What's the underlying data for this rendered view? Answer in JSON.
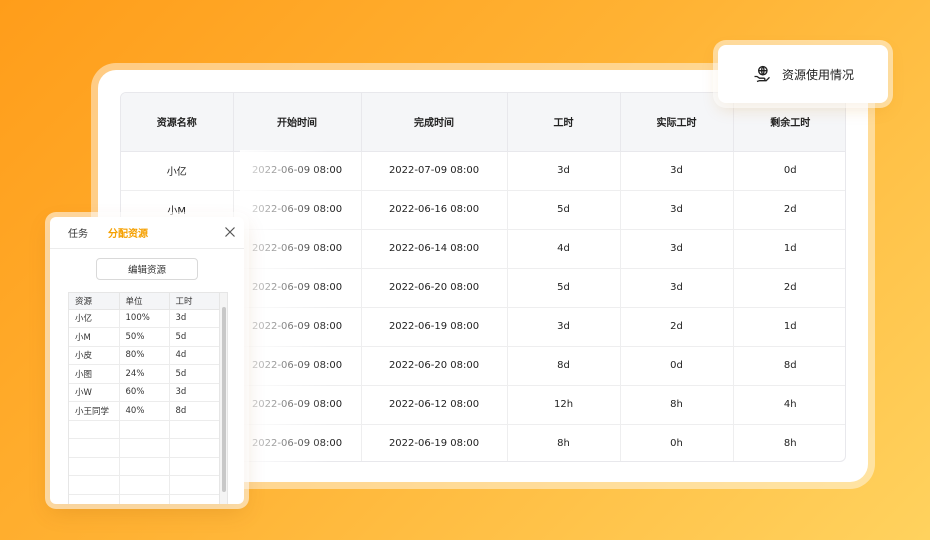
{
  "badge": {
    "label": "资源使用情况",
    "icon": "globe-hand-icon"
  },
  "table": {
    "headers": [
      "资源名称",
      "开始时间",
      "完成时间",
      "工时",
      "实际工时",
      "剩余工时"
    ],
    "rows": [
      [
        "小亿",
        "2022-06-09 08:00",
        "2022-07-09 08:00",
        "3d",
        "3d",
        "0d"
      ],
      [
        "小M",
        "2022-06-09 08:00",
        "2022-06-16 08:00",
        "5d",
        "3d",
        "2d"
      ],
      [
        "",
        "2022-06-09 08:00",
        "2022-06-14 08:00",
        "4d",
        "3d",
        "1d"
      ],
      [
        "",
        "2022-06-09 08:00",
        "2022-06-20 08:00",
        "5d",
        "3d",
        "2d"
      ],
      [
        "",
        "2022-06-09 08:00",
        "2022-06-19 08:00",
        "3d",
        "2d",
        "1d"
      ],
      [
        "",
        "2022-06-09 08:00",
        "2022-06-20 08:00",
        "8d",
        "0d",
        "8d"
      ],
      [
        "",
        "2022-06-09 08:00",
        "2022-06-12 08:00",
        "12h",
        "8h",
        "4h"
      ],
      [
        "",
        "2022-06-09 08:00",
        "2022-06-19 08:00",
        "8h",
        "0h",
        "8h"
      ]
    ]
  },
  "panel": {
    "tabs": [
      {
        "label": "任务",
        "active": false
      },
      {
        "label": "分配资源",
        "active": true
      }
    ],
    "close_icon": "close-icon",
    "edit_button": "编辑资源",
    "headers": [
      "资源",
      "单位",
      "工时"
    ],
    "rows": [
      [
        "小亿",
        "100%",
        "3d"
      ],
      [
        "小M",
        "50%",
        "5d"
      ],
      [
        "小皮",
        "80%",
        "4d"
      ],
      [
        "小图",
        "24%",
        "5d"
      ],
      [
        "小W",
        "60%",
        "3d"
      ],
      [
        "小王同学",
        "40%",
        "8d"
      ]
    ],
    "empty_rows": 5
  },
  "colors": {
    "accent": "#f5a000",
    "background_start": "#ff9d1a",
    "background_end": "#ffd25e"
  }
}
